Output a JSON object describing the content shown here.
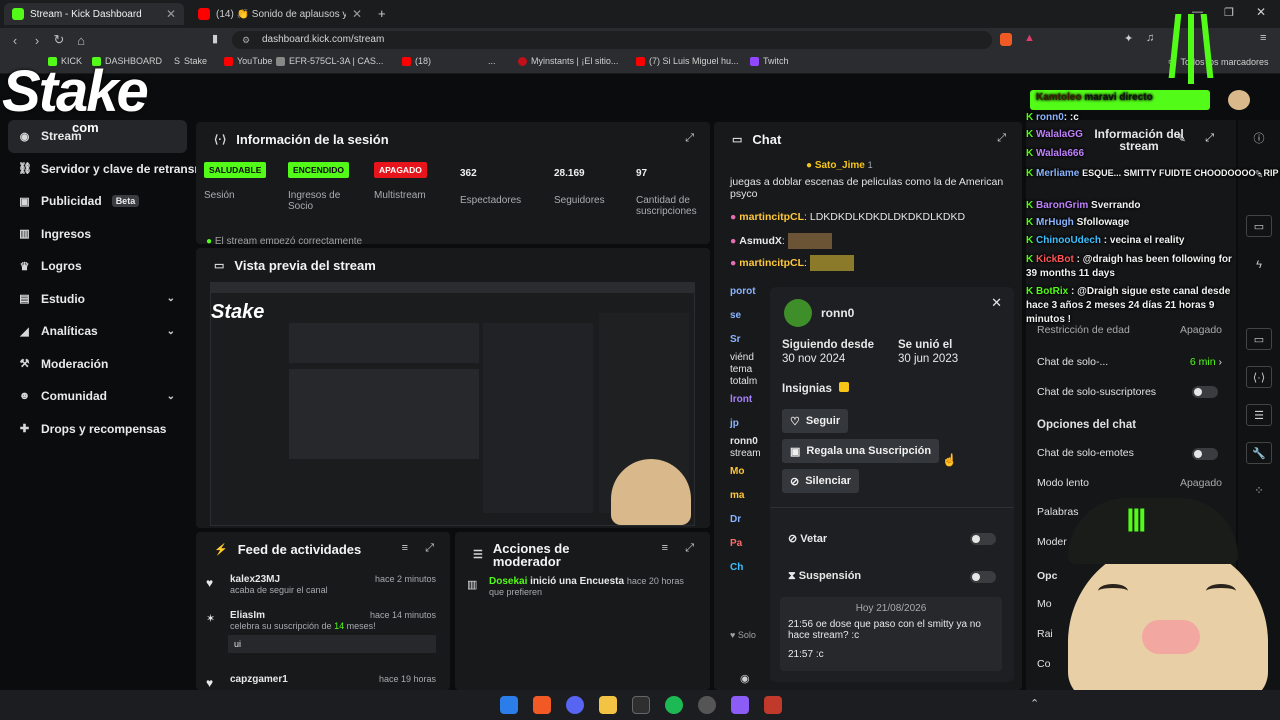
{
  "browser": {
    "tabs": [
      {
        "label": "Stream - Kick Dashboard",
        "active": true
      },
      {
        "label": "(14) 👏 Sonido de aplausos y gri",
        "active": false
      }
    ],
    "url": "dashboard.kick.com/stream",
    "bookmarks": [
      "KICK",
      "DASHBOARD",
      "Stake",
      "YouTube",
      "EFR-575CL-3A | CAS...",
      "(18)",
      "...",
      "Myinstants | ¡El sitio...",
      "(7) Si Luis Miguel hu...",
      "Twitch"
    ],
    "bookmarks_all": "Todos los marcadores"
  },
  "overlay": {
    "logo_text": "Stake",
    "logo_sub": "com"
  },
  "sidebar": {
    "items": [
      {
        "label": "Stream",
        "icon": "broadcast-icon"
      },
      {
        "label": "Servidor y clave de retransmisión",
        "icon": "link-icon"
      },
      {
        "label": "Publicidad",
        "icon": "ads-icon",
        "badge": "Beta"
      },
      {
        "label": "Ingresos",
        "icon": "chart-icon"
      },
      {
        "label": "Logros",
        "icon": "trophy-icon"
      },
      {
        "label": "Estudio",
        "icon": "studio-icon",
        "chevron": true
      },
      {
        "label": "Analíticas",
        "icon": "analytics-icon",
        "chevron": true
      },
      {
        "label": "Moderación",
        "icon": "hammer-icon"
      },
      {
        "label": "Comunidad",
        "icon": "people-icon",
        "chevron": true
      },
      {
        "label": "Drops y recompensas",
        "icon": "gift-icon"
      }
    ]
  },
  "session": {
    "title": "Información de la sesión",
    "stats": [
      {
        "pill": "SALUDABLE",
        "label": "Sesión",
        "color": "#53fc18"
      },
      {
        "pill": "ENCENDIDO",
        "label": "Ingresos de Socio",
        "color": "#53fc18"
      },
      {
        "pill": "APAGADO",
        "label": "Multistream",
        "color": "#e8141b"
      },
      {
        "value": "362",
        "label": "Espectadores"
      },
      {
        "value": "28.169",
        "label": "Seguidores"
      },
      {
        "value": "97",
        "label": "Cantidad de suscripciones"
      }
    ],
    "status_line": "El stream empezó correctamente"
  },
  "preview": {
    "title": "Vista previa del stream"
  },
  "feed": {
    "title": "Feed de actividades",
    "items": [
      {
        "user": "kalex23MJ",
        "time": "hace 2 minutos",
        "detail": "acaba de seguir el canal"
      },
      {
        "user": "EliasIm",
        "time": "hace 14 minutos",
        "detail_pre": "celebra su suscripción de ",
        "detail_num": "14",
        "detail_post": " meses!",
        "message": "ui"
      },
      {
        "user": "capzgamer1",
        "time": "hace 19 horas"
      }
    ]
  },
  "modactions": {
    "title": "Acciones de moderador",
    "items": [
      {
        "user": "Dosekai",
        "text": "inició una Encuesta",
        "time": "hace 20 horas",
        "detail": "que prefieren"
      }
    ]
  },
  "chat": {
    "title": "Chat",
    "pinned_user": "Sato_Jime",
    "pinned_count": "1",
    "messages": [
      {
        "text": "juegas a doblar escenas de peliculas como la de American psyco"
      },
      {
        "user": "martincitpCL",
        "text": "LDKDKDLKDKDLDKDKDLKDKD"
      },
      {
        "user": "AsmudX",
        "text": ""
      },
      {
        "user": "martincitpCL",
        "text": ""
      }
    ],
    "partial_users": [
      "porot",
      "se",
      "Sr",
      "viénd",
      "tema",
      "totalm",
      "lront",
      "jp",
      "ronn0",
      "stream",
      "Mo",
      "ma",
      "Dr",
      "Pa",
      "Ch"
    ],
    "footer": "Solo"
  },
  "user_card": {
    "username": "ronn0",
    "following_label": "Siguiendo desde",
    "following_date": "30 nov 2024",
    "joined_label": "Se unió el",
    "joined_date": "30 jun 2023",
    "badges_label": "Insignias",
    "follow_btn": "Seguir",
    "gift_btn": "Regala una Suscripción",
    "mute_btn": "Silenciar",
    "ban_label": "Vetar",
    "timeout_label": "Suspensión",
    "history_date": "Hoy 21/08/2026",
    "history": [
      {
        "time": "21:56",
        "text": "oe dose que paso con el smitty ya no hace stream? :c"
      },
      {
        "time": "21:57",
        "text": ":c"
      }
    ]
  },
  "settings": {
    "title": "Información del stream",
    "rows": [
      {
        "label": "Restricción de edad",
        "value": "Apagado"
      },
      {
        "label": "Chat de solo-...",
        "value": "6 min"
      },
      {
        "label": "Chat de solo-suscriptores",
        "toggle": true
      }
    ],
    "section": "Opciones del chat",
    "rows2": [
      {
        "label": "Chat de solo-emotes",
        "toggle": true
      },
      {
        "label": "Modo lento",
        "value": "Apagado"
      },
      {
        "label": "Palabras"
      },
      {
        "label": "Moder"
      },
      {
        "label": "Opc"
      },
      {
        "label": "Mo"
      },
      {
        "label": "Rai"
      },
      {
        "label": "Co"
      }
    ]
  },
  "stream_overlay_chat": [
    {
      "user": "Kamtoleo",
      "text": "maravi directo"
    },
    {
      "user": "ronn0",
      "text": ": :c"
    },
    {
      "user": "WalalaGG",
      "text": ""
    },
    {
      "user": "Walala666",
      "text": ""
    },
    {
      "user": "Merliame",
      "text": "ESQUE... SMITTY FUIDTE CHOODOOOO - RIP P..."
    },
    {
      "user": "BaronGrim",
      "text": "Sverrando"
    },
    {
      "user": "MrHugh",
      "text": "Sfollowage"
    },
    {
      "user": "ChinooUdech",
      "text": ": vecina el reality"
    },
    {
      "user": "KickBot",
      "text": ": @draigh has been following for 39 months 11 days"
    },
    {
      "user": "BotRix",
      "text": ": @Draigh sigue este canal desde hace 3 años 2 meses 24 días 21 horas 9 minutos !"
    }
  ],
  "colors": {
    "kick_green": "#53fc18",
    "danger": "#e8141b",
    "panel": "#18191b"
  }
}
